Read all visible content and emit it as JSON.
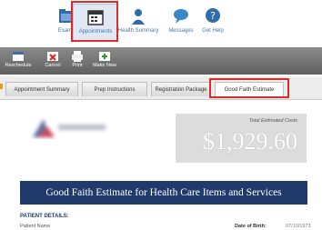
{
  "nav": {
    "items": [
      {
        "label": "Exams"
      },
      {
        "label": "Appointments"
      },
      {
        "label": "Health Summary"
      },
      {
        "label": "Messages"
      },
      {
        "label": "Get Help"
      }
    ]
  },
  "toolbar": {
    "buttons": [
      {
        "label": "Reschedule"
      },
      {
        "label": "Cancel"
      },
      {
        "label": "Print"
      },
      {
        "label": "Make New"
      }
    ]
  },
  "tabs": [
    {
      "label": "Appointment Summary"
    },
    {
      "label": "Prep Instructions"
    },
    {
      "label": "Registration Package"
    },
    {
      "label": "Good Faith Estimate"
    }
  ],
  "estimate": {
    "cost_label": "Total Estimated Costs",
    "cost_amount": "$1,929.60",
    "banner_title": "Good Faith Estimate for Health Care Items and Services",
    "patient_details_title": "PATIENT DETAILS:",
    "patient_name_label": "Patient Name",
    "dob_label": "Date of Birth:",
    "dob_value": "07/10/1973"
  },
  "colors": {
    "highlight": "#e02a2a",
    "banner": "#1f3a6b",
    "link": "#4a78a8"
  }
}
